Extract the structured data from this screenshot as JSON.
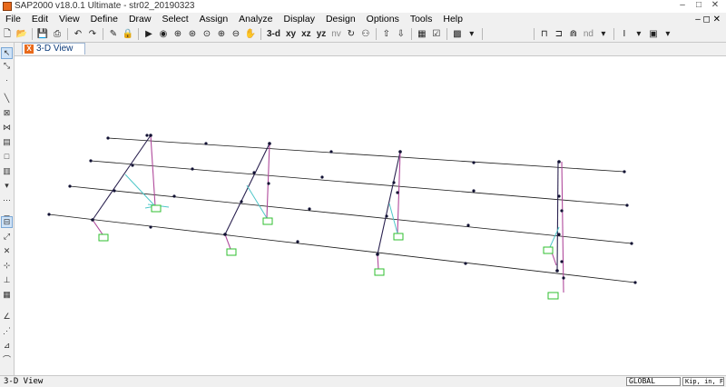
{
  "window": {
    "title": "SAP2000 v18.0.1 Ultimate  - str02_20190323"
  },
  "menu": [
    "File",
    "Edit",
    "View",
    "Define",
    "Draw",
    "Select",
    "Assign",
    "Analyze",
    "Display",
    "Design",
    "Options",
    "Tools",
    "Help"
  ],
  "toolbar": {
    "view_3d": "3-d",
    "view_xy": "xy",
    "view_xz": "xz",
    "view_yz": "yz",
    "view_nv": "nv",
    "nd": "nd"
  },
  "tab": {
    "label": "3-D View"
  },
  "status": {
    "left": "3-D View",
    "coord_system": "GLOBAL",
    "units": "Kip, in, F"
  },
  "colors": {
    "grid": "#1a1a1a",
    "frame": "#2b2250",
    "column": "#b04a9c",
    "brace": "#4fc7c9",
    "support": "#2fbf2f",
    "joint": "#111133"
  }
}
